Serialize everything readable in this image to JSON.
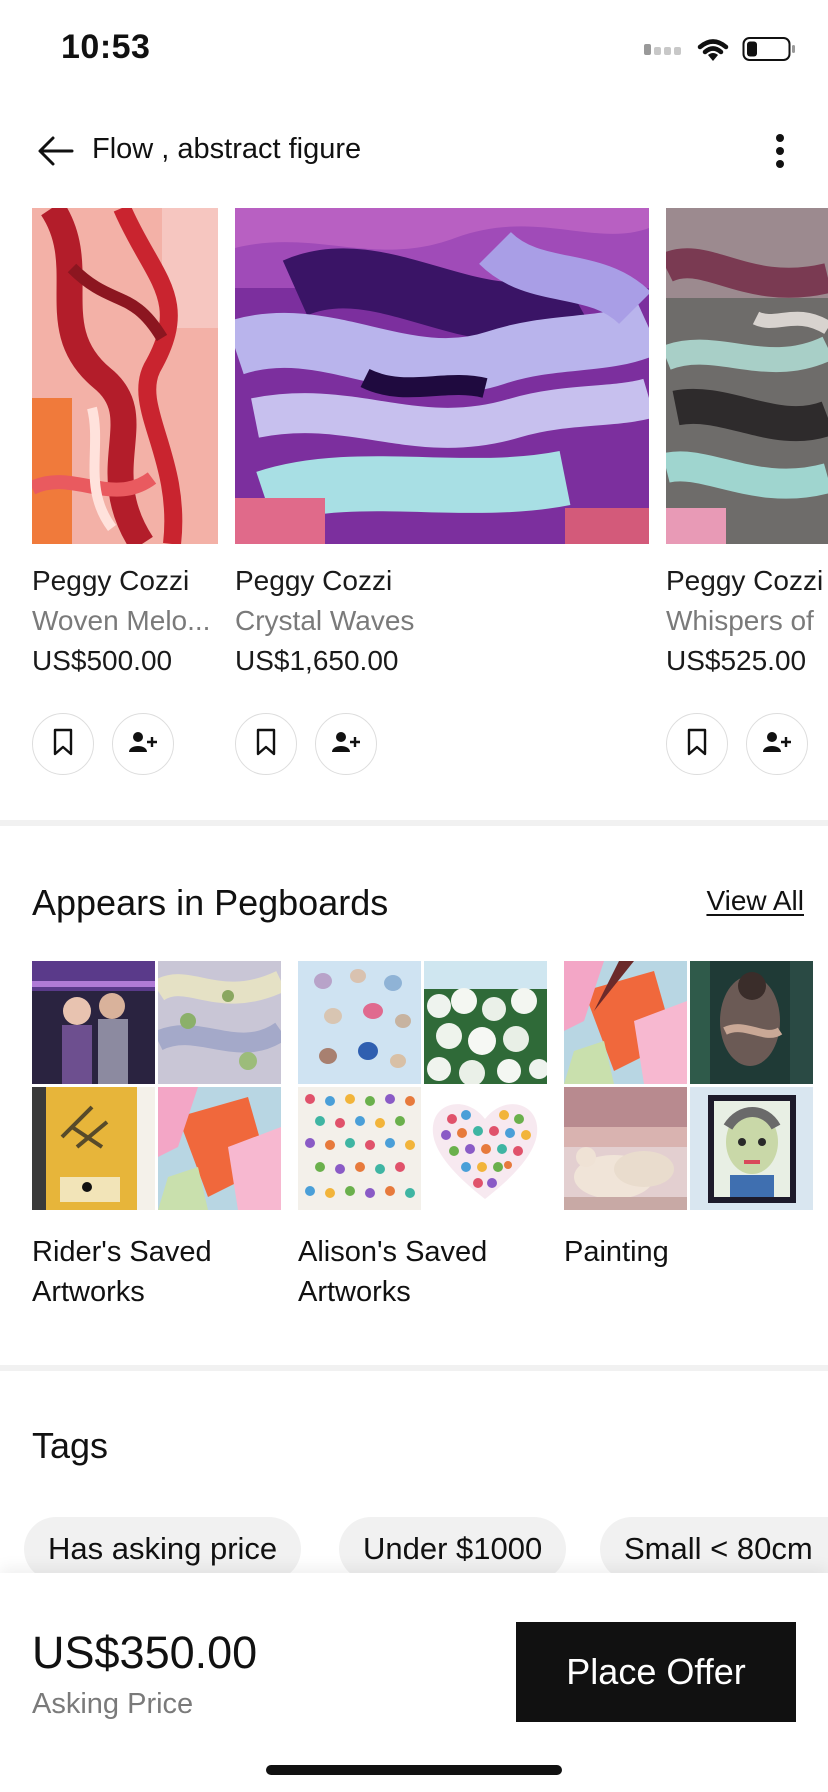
{
  "status_bar": {
    "time": "10:53"
  },
  "header": {
    "title": "Flow , abstract figure"
  },
  "artworks": [
    {
      "artist": "Peggy Cozzi",
      "title": "Woven Melo...",
      "price": "US$500.00"
    },
    {
      "artist": "Peggy Cozzi",
      "title": "Crystal Waves",
      "price": "US$1,650.00"
    },
    {
      "artist": "Peggy Cozzi",
      "title": "Whispers of",
      "price": "US$525.00"
    }
  ],
  "pegboards": {
    "title": "Appears in Pegboards",
    "view_all": "View All",
    "boards": [
      {
        "label": "Rider's Saved Artworks"
      },
      {
        "label": "Alison's Saved Artworks"
      },
      {
        "label": "Painting"
      }
    ]
  },
  "tags": {
    "title": "Tags",
    "items": [
      "Has asking price",
      "Under $1000",
      "Small < 80cm"
    ]
  },
  "bottom": {
    "price": "US$350.00",
    "price_label": "Asking Price",
    "offer_button": "Place Offer"
  },
  "colors": {
    "button_bg": "#111111",
    "muted_text": "#7a7a7a",
    "chip_bg": "#f1f1f1"
  }
}
